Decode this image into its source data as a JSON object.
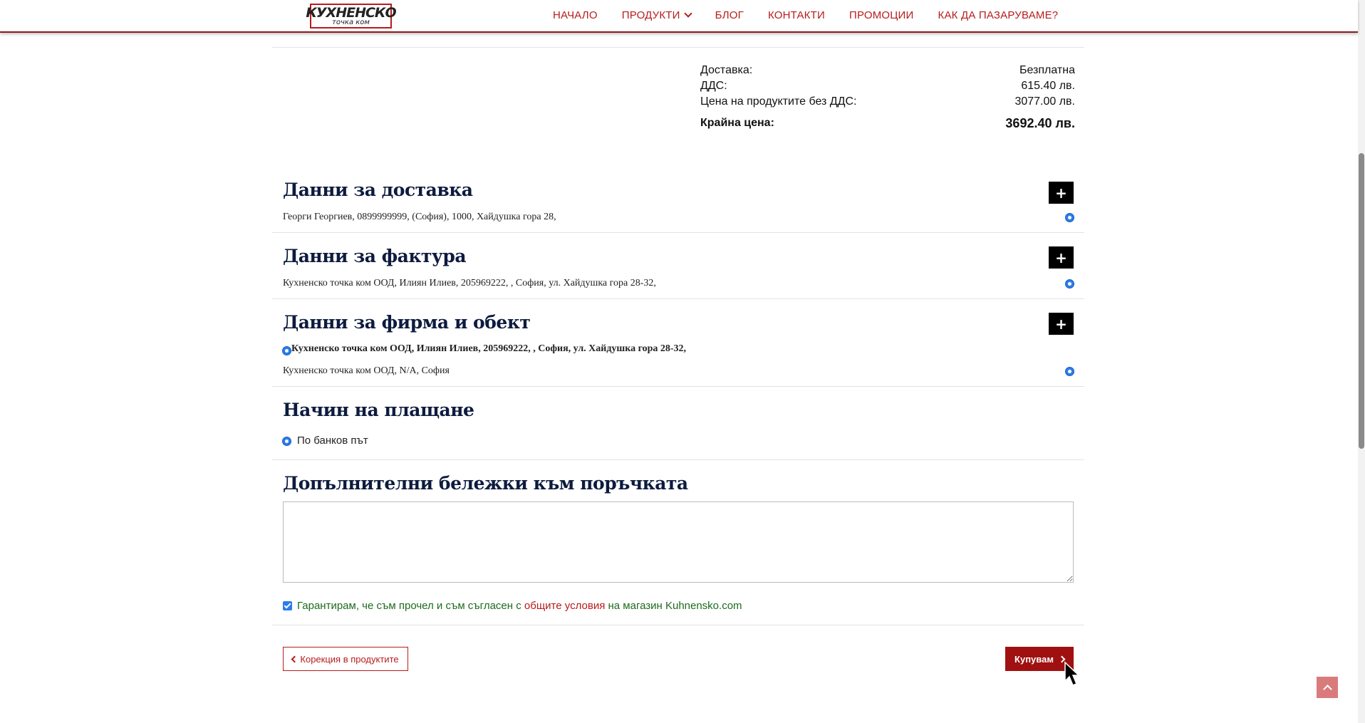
{
  "header": {
    "logo_line1": "КУХНЕНСКО",
    "logo_line2": "точка ком",
    "nav": [
      {
        "label": "НАЧАЛО"
      },
      {
        "label": "ПРОДУКТИ"
      },
      {
        "label": "БЛОГ"
      },
      {
        "label": "КОНТАКТИ"
      },
      {
        "label": "ПРОМОЦИИ"
      },
      {
        "label": "КАК ДА ПАЗАРУВАМЕ?"
      }
    ]
  },
  "totals": {
    "delivery_label": "Доставка:",
    "delivery_value": "Безплатна",
    "vat_label": "ДДС:",
    "vat_value": "615.40 лв.",
    "net_label": "Цена на продуктите без ДДС:",
    "net_value": "3077.00 лв.",
    "final_label": "Крайна цена:",
    "final_value": "3692.40 лв."
  },
  "delivery": {
    "title": "Данни за доставка",
    "text": "Георги Георгиев, 0899999999, (София), 1000, Хайдушка гора 28,"
  },
  "invoice": {
    "title": "Данни за фактура",
    "text": "Кухненско точка ком ООД, Илиян Илиев, 205969222, , София, ул. Хайдушка гора 28-32,"
  },
  "company": {
    "title": "Данни за фирма и обект",
    "text_bold": "Кухненско точка ком ООД, Илиян Илиев, 205969222, , София, ул. Хайдушка гора 28-32,",
    "text": "Кухненско точка ком ООД, N/A, София"
  },
  "payment": {
    "title": "Начин на плащане",
    "option": "По банков път"
  },
  "notes": {
    "title": "Допълнителни бележки към поръчката",
    "value": ""
  },
  "terms": {
    "prefix": "Гарантирам, че съм прочел и съм съгласен с ",
    "link": "общите условия",
    "suffix": " на магазин Kuhnensko.com"
  },
  "actions": {
    "back_label": "Корекция в продуктите",
    "buy_label": "Купувам"
  },
  "colors": {
    "accent": "#b71c1c",
    "radio": "#2b7de9",
    "terms_text": "#1e6b1e"
  }
}
